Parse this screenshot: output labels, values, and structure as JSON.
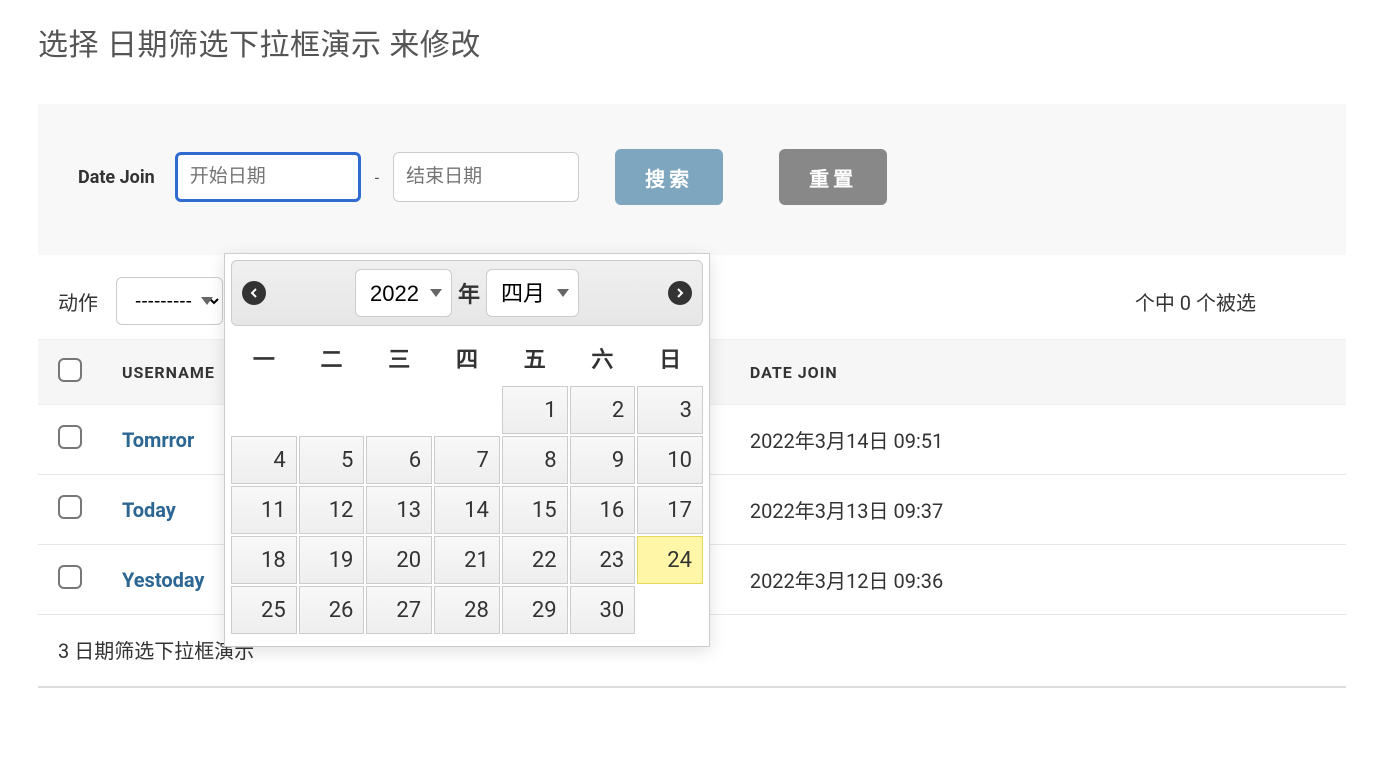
{
  "page_title": "选择 日期筛选下拉框演示 来修改",
  "toolbar": {
    "label": "Date Join",
    "start_placeholder": "开始日期",
    "end_placeholder": "结束日期",
    "separator": "-",
    "search_label": "搜索",
    "reset_label": "重置"
  },
  "actions": {
    "label": "动作",
    "select_value": "---------",
    "selection_text": "个中 0 个被选"
  },
  "table": {
    "head_username": "USERNAME",
    "head_datejoin": "DATE JOIN",
    "rows": [
      {
        "username": "Tomrror",
        "datejoin": "2022年3月14日 09:51"
      },
      {
        "username": "Today",
        "datejoin": "2022年3月13日 09:37"
      },
      {
        "username": "Yestoday",
        "datejoin": "2022年3月12日 09:36"
      }
    ]
  },
  "footer_text": "3 日期筛选下拉框演示",
  "datepicker": {
    "year": "2022",
    "year_suffix": "年",
    "month": "四月",
    "dow": [
      "一",
      "二",
      "三",
      "四",
      "五",
      "六",
      "日"
    ],
    "leading_blanks": 4,
    "days": 30,
    "today": 24
  }
}
